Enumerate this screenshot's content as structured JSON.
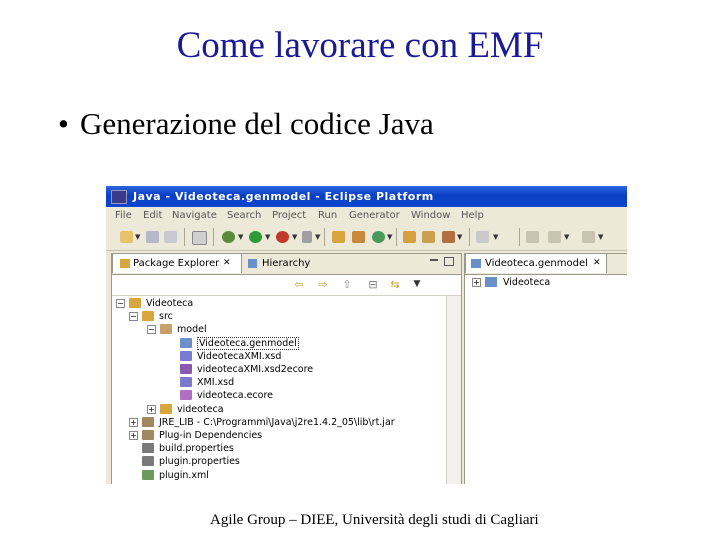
{
  "slide": {
    "title": "Come lavorare con EMF",
    "bullet": "Generazione del codice Java",
    "footer": "Agile Group – DIEE, Università degli studi di Cagliari"
  },
  "window": {
    "title": "Java - Videoteca.genmodel - Eclipse Platform"
  },
  "menu": [
    "File",
    "Edit",
    "Navigate",
    "Search",
    "Project",
    "Run",
    "Generator",
    "Window",
    "Help"
  ],
  "left_pane": {
    "tabs": [
      {
        "label": "Package Explorer",
        "close": "✕"
      },
      {
        "label": "Hierarchy"
      }
    ]
  },
  "tree": [
    {
      "label": "Videoteca",
      "level": 0,
      "expander": "−",
      "icon": "project-icon",
      "color": "#d9a53f"
    },
    {
      "label": "src",
      "level": 1,
      "expander": "−",
      "icon": "source-folder-icon",
      "color": "#d9a53f"
    },
    {
      "label": "model",
      "level": 2,
      "expander": "−",
      "icon": "package-icon",
      "color": "#c9a06a"
    },
    {
      "label": "Videoteca.genmodel",
      "level": 3,
      "icon": "genmodel-file-icon",
      "color": "#6b8fc8",
      "selected": true
    },
    {
      "label": "VideotecaXMI.xsd",
      "level": 3,
      "icon": "xsd-file-icon",
      "color": "#7a7ad0"
    },
    {
      "label": "videotecaXMI.xsd2ecore",
      "level": 3,
      "icon": "xsd2ecore-file-icon",
      "color": "#8a5ab0"
    },
    {
      "label": "XMI.xsd",
      "level": 3,
      "icon": "xsd-file-icon",
      "color": "#7a7ad0"
    },
    {
      "label": "videoteca.ecore",
      "level": 3,
      "icon": "ecore-file-icon",
      "color": "#b06fc0"
    },
    {
      "label": "videoteca",
      "level": 2,
      "expander": "+",
      "icon": "package-icon",
      "color": "#d9a53f"
    },
    {
      "label": "JRE_LIB - C:\\Programmi\\Java\\j2re1.4.2_05\\lib\\rt.jar",
      "level": 1,
      "expander": "+",
      "icon": "jar-icon",
      "color": "#a08860"
    },
    {
      "label": "Plug-in Dependencies",
      "level": 1,
      "expander": "+",
      "icon": "library-icon",
      "color": "#a08860"
    },
    {
      "label": "build.properties",
      "level": 1,
      "icon": "properties-file-icon",
      "color": "#7a7a7a"
    },
    {
      "label": "plugin.properties",
      "level": 1,
      "icon": "properties-file-icon",
      "color": "#7a7a7a"
    },
    {
      "label": "plugin.xml",
      "level": 1,
      "icon": "plugin-xml-icon",
      "color": "#6b9a5a"
    }
  ],
  "right_pane": {
    "tab": {
      "label": "Videoteca.genmodel",
      "close": "✕"
    },
    "tree_root": {
      "label": "Videoteca",
      "expander": "+"
    }
  }
}
